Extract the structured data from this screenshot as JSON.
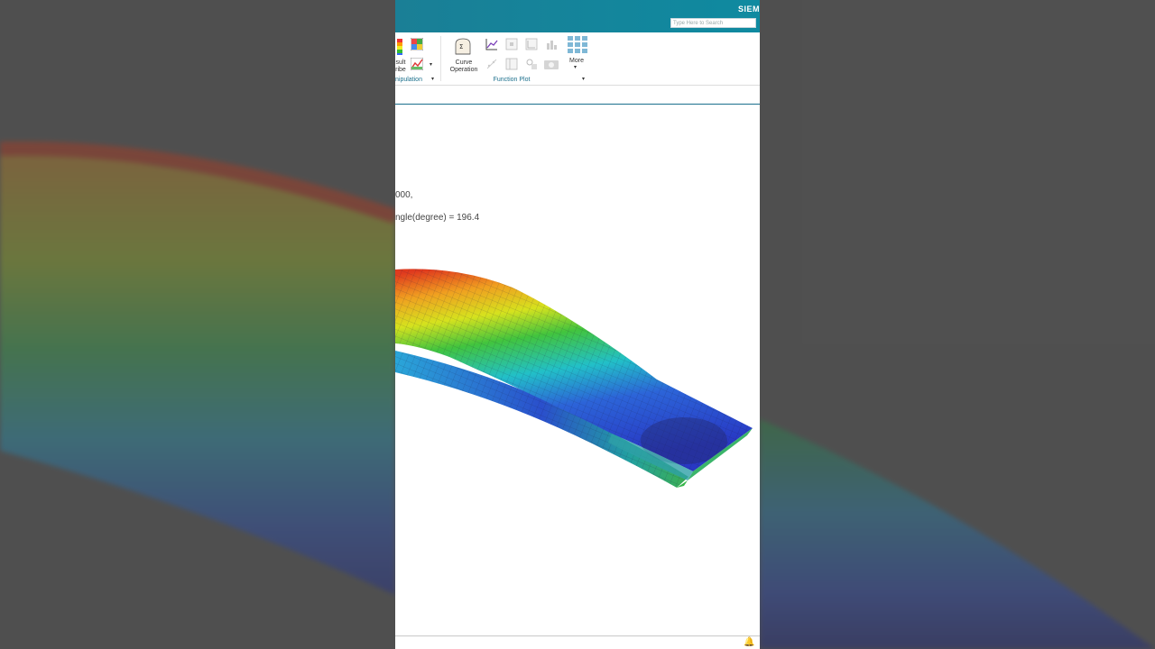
{
  "titlebar": {
    "brand": "SIEM",
    "search_placeholder": "Type Here to Search"
  },
  "ribbon": {
    "left_labels": {
      "line1": "sult",
      "line2": "ribe"
    },
    "manip_group": "nipulation",
    "curve_operation": {
      "line1": "Curve",
      "line2": "Operation"
    },
    "more": "More",
    "function_plot_group": "Function Plot"
  },
  "viewport": {
    "line1": "000,",
    "line2": "ngle(degree) = 196.4"
  },
  "colors": {
    "titlebar": "#1a7f96",
    "accent": "#1b6f8c"
  }
}
